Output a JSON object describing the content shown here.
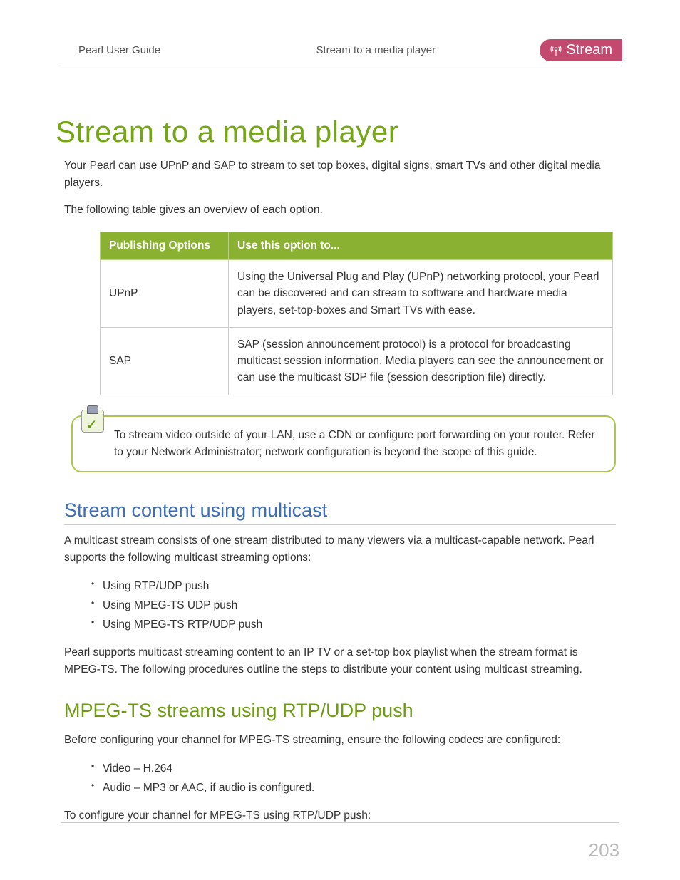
{
  "header": {
    "left": "Pearl User Guide",
    "center": "Stream to a media player",
    "badge_label": "Stream"
  },
  "title": "Stream to a media player",
  "intro_p1": "Your Pearl can use UPnP and SAP to stream to set top boxes, digital signs, smart TVs and other digital media players.",
  "intro_p2": "The following table gives an overview of each option.",
  "table": {
    "col1": "Publishing Options",
    "col2": "Use this option to...",
    "rows": [
      {
        "option": "UPnP",
        "desc": "Using the Universal Plug and Play (UPnP) networking protocol, your Pearl can be discovered and can stream to software and hardware media players, set-top-boxes and Smart TVs with ease."
      },
      {
        "option": "SAP",
        "desc": "SAP (session announcement protocol) is a protocol for broadcasting multicast session information. Media players can see the announcement or can use the multicast SDP file (session description file) directly."
      }
    ]
  },
  "callout": "To stream video outside of your LAN, use a CDN or configure port forwarding on your router. Refer to your Network Administrator; network configuration is beyond the scope of this guide.",
  "section1": {
    "heading": "Stream content using multicast",
    "p1": "A multicast stream consists of one stream distributed to many viewers via a multicast-capable network. Pearl supports the following multicast streaming options:",
    "bullets": [
      "Using RTP/UDP push",
      "Using MPEG-TS UDP push",
      "Using MPEG-TS RTP/UDP push"
    ],
    "p2": "Pearl supports multicast streaming content to an IP TV or a set-top box playlist when the stream format is MPEG-TS. The following procedures outline the steps to distribute your content using multicast streaming."
  },
  "section2": {
    "heading": "MPEG-TS streams using RTP/UDP push",
    "p1": "Before configuring your channel for MPEG-TS streaming, ensure the following codecs are configured:",
    "bullets": [
      "Video – H.264",
      "Audio – MP3 or AAC, if audio is configured."
    ],
    "p2": "To configure your channel for MPEG-TS using RTP/UDP push:"
  },
  "page_number": "203"
}
